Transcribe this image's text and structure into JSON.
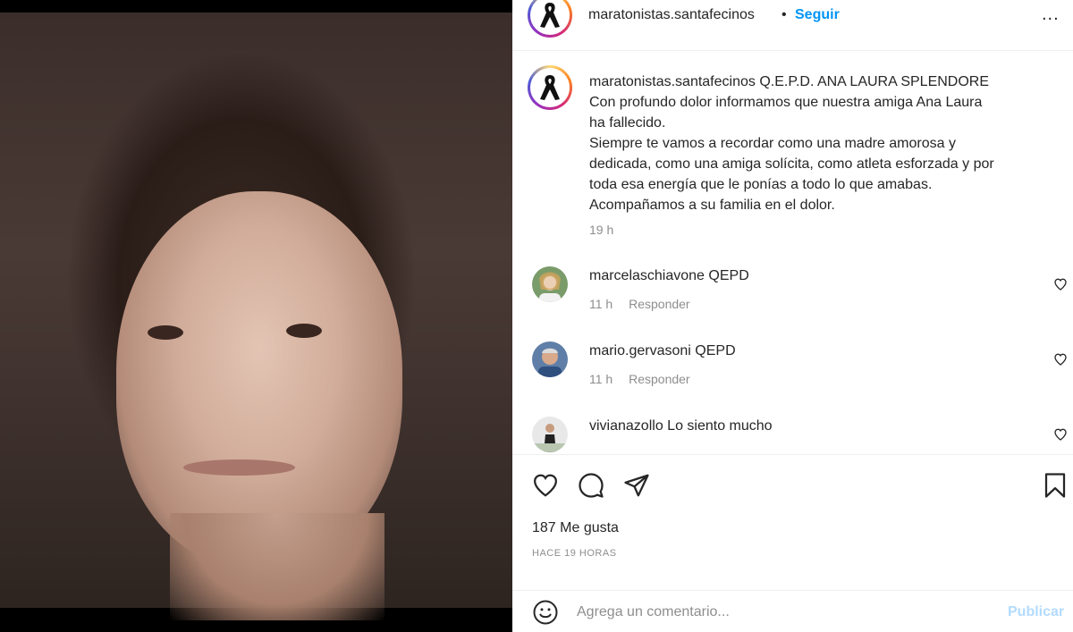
{
  "post": {
    "author": "maratonistas.santafecinos",
    "follow_separator": "•",
    "follow_label": "Seguir",
    "more_label": "...",
    "caption": {
      "username": "maratonistas.santafecinos",
      "lines": [
        "Q.E.P.D. ANA LAURA SPLENDORE",
        "Con profundo dolor informamos que nuestra amiga Ana Laura",
        "ha fallecido.",
        "Siempre te vamos a recordar como una madre amorosa y",
        "dedicada, como una amiga solícita, como atleta esforzada y por",
        "toda esa energía que le ponías a todo lo que amabas.",
        "Acompañamos a su familia en el dolor."
      ],
      "time": "19 h"
    },
    "comments": [
      {
        "user": "marcelaschiavone",
        "text": "QEPD",
        "time": "11 h",
        "reply_label": "Responder"
      },
      {
        "user": "mario.gervasoni",
        "text": "QEPD",
        "time": "11 h",
        "reply_label": "Responder"
      },
      {
        "user": "vivianazollo",
        "text": "Lo siento mucho"
      }
    ],
    "likes": "187 Me gusta",
    "timestamp": "HACE 19 HORAS",
    "add_comment": {
      "placeholder": "Agrega un comentario...",
      "publish_label": "Publicar"
    }
  },
  "icons": {
    "avatar": "black-ribbon-icon",
    "like": "heart-icon",
    "comment": "comment-bubble-icon",
    "share": "paper-plane-icon",
    "save": "bookmark-icon",
    "emoji": "smiley-icon"
  },
  "colors": {
    "link": "#0095f6",
    "muted": "#8e8e8e",
    "publish_disabled": "#b3dbff"
  }
}
